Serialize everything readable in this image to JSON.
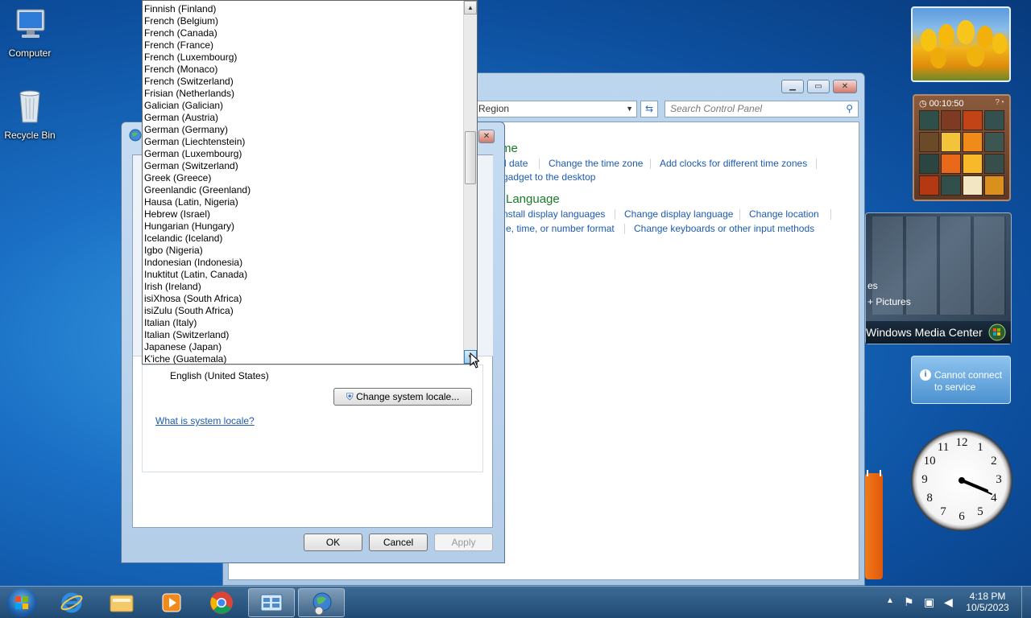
{
  "desktop": {
    "icons": [
      {
        "label": "Computer"
      },
      {
        "label": "Recycle Bin"
      }
    ]
  },
  "control_panel": {
    "address_text": "d Region",
    "search_placeholder": "Search Control Panel",
    "sections": {
      "datetime": {
        "title": "me",
        "links": [
          "d date",
          "Change the time zone",
          "Add clocks for different time zones"
        ],
        "link2": "gadget to the desktop"
      },
      "language": {
        "title": "Language",
        "links_row1": [
          "nstall display languages",
          "Change display language",
          "Change location"
        ],
        "links_row2": [
          "e, time, or number format",
          "Change keyboards or other input methods"
        ]
      }
    }
  },
  "region_dialog": {
    "current_locale": "English (United States)",
    "change_button": "Change system locale...",
    "help_link": "What is system locale?",
    "ok": "OK",
    "cancel": "Cancel",
    "apply": "Apply"
  },
  "locale_dropdown": {
    "items": [
      "Finnish (Finland)",
      "French (Belgium)",
      "French (Canada)",
      "French (France)",
      "French (Luxembourg)",
      "French (Monaco)",
      "French (Switzerland)",
      "Frisian (Netherlands)",
      "Galician (Galician)",
      "German (Austria)",
      "German (Germany)",
      "German (Liechtenstein)",
      "German (Luxembourg)",
      "German (Switzerland)",
      "Greek (Greece)",
      "Greenlandic (Greenland)",
      "Hausa (Latin, Nigeria)",
      "Hebrew (Israel)",
      "Hungarian (Hungary)",
      "Icelandic (Iceland)",
      "Igbo (Nigeria)",
      "Indonesian (Indonesia)",
      "Inuktitut (Latin, Canada)",
      "Irish (Ireland)",
      "isiXhosa (South Africa)",
      "isiZulu (South Africa)",
      "Italian (Italy)",
      "Italian (Switzerland)",
      "Japanese (Japan)",
      "K'iche (Guatemala)"
    ]
  },
  "gadgets": {
    "puzzle_timer": "00:10:50",
    "media_center_label": "Windows Media Center",
    "media_center_pictures": "+ Pictures",
    "media_center_partial": "es",
    "weather_message": "Cannot connect to service",
    "clock_numbers": [
      "12",
      "1",
      "2",
      "3",
      "4",
      "5",
      "6",
      "7",
      "8",
      "9",
      "10",
      "11"
    ]
  },
  "taskbar": {
    "time": "4:18 PM",
    "date": "10/5/2023"
  }
}
